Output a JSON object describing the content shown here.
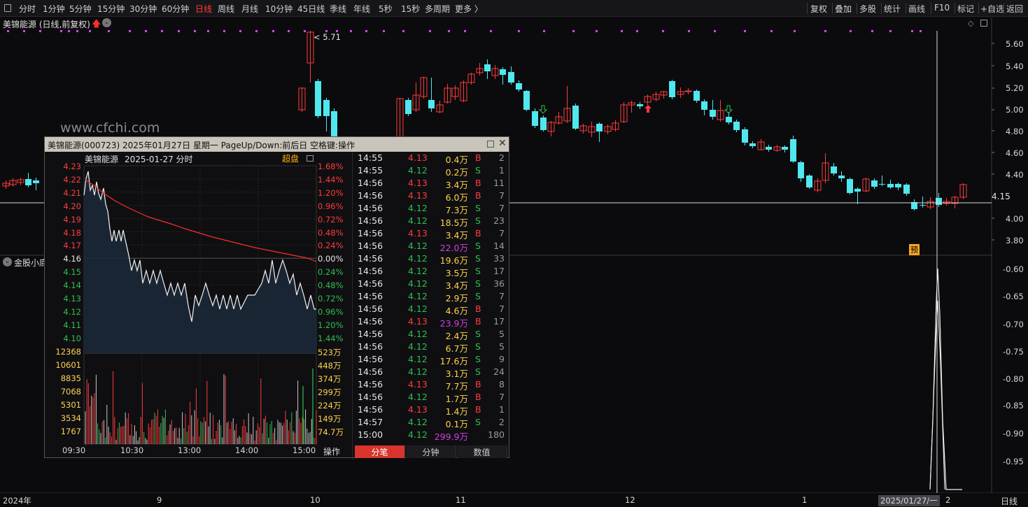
{
  "toolbar": {
    "periods": [
      "分时",
      "1分钟",
      "5分钟",
      "15分钟",
      "30分钟",
      "60分钟",
      "日线",
      "周线",
      "月线",
      "10分钟",
      "45日线",
      "季线",
      "年线",
      "5秒",
      "15秒",
      "多周期",
      "更多 〉"
    ],
    "active_period": "日线",
    "right_items": [
      "复权",
      "叠加",
      "多股",
      "统计",
      "画线",
      "F10",
      "标记",
      "+自选",
      "返回"
    ]
  },
  "chart": {
    "title": "美锦能源 (日线,前复权)",
    "peak_label": "5.71",
    "watermark": "www.cfchi.com",
    "last_price": "4.15",
    "y_ticks": [
      "5.60",
      "5.40",
      "5.20",
      "5.00",
      "4.80",
      "4.60",
      "4.40",
      "4.00",
      "3.80"
    ],
    "indicator_name": "金股小底",
    "ind_ticks": [
      "-0.60",
      "-0.65",
      "-0.70",
      "-0.75",
      "-0.80",
      "-0.85",
      "-0.90",
      "-0.95"
    ],
    "pre_badge": "预",
    "x_labels": [
      "2024年",
      "9",
      "10",
      "11",
      "12",
      "1",
      "2025/01/27/一",
      "2"
    ],
    "period_corner": "日线",
    "colors": {
      "up": "#ff3b3b",
      "down": "#4fe8f0",
      "bg": "#0b0b0d",
      "yellow": "#ffd24d",
      "green": "#2fbf4f"
    }
  },
  "popup": {
    "title": "美锦能源(000723)  2025年01月27日 星期一  PageUp/Down:前后日  空格键:操作",
    "stock_name": "美锦能源",
    "date_label": "2025-01-27 分时",
    "super_label": "超盘",
    "price_ticks": [
      "4.23",
      "4.22",
      "4.21",
      "4.20",
      "4.19",
      "4.18",
      "4.17",
      "4.16",
      "4.15",
      "4.14",
      "4.13",
      "4.12",
      "4.11",
      "4.10"
    ],
    "pct_ticks": [
      "1.68%",
      "1.44%",
      "1.20%",
      "0.96%",
      "0.72%",
      "0.48%",
      "0.24%",
      "0.00%",
      "0.24%",
      "0.48%",
      "0.72%",
      "0.96%",
      "1.20%",
      "1.44%"
    ],
    "vol_ticks_left": [
      "12368",
      "10601",
      "8835",
      "7068",
      "5301",
      "3534",
      "1767"
    ],
    "vol_ticks_right": [
      "523万",
      "448万",
      "374万",
      "299万",
      "224万",
      "149万",
      "74.7万"
    ],
    "time_labels": [
      "09:30",
      "10:30",
      "13:00",
      "14:00",
      "15:00"
    ],
    "op_label": "操作",
    "tabs": [
      "分笔",
      "分钟",
      "数值"
    ],
    "active_tab": "分笔",
    "trades": [
      {
        "time": "14:55",
        "price": "4.13",
        "amount": "0.4万",
        "side": "B",
        "count": "2"
      },
      {
        "time": "14:55",
        "price": "4.12",
        "amount": "0.2万",
        "side": "S",
        "count": "1"
      },
      {
        "time": "14:56",
        "price": "4.13",
        "amount": "3.4万",
        "side": "B",
        "count": "11"
      },
      {
        "time": "14:56",
        "price": "4.13",
        "amount": "6.0万",
        "side": "B",
        "count": "7"
      },
      {
        "time": "14:56",
        "price": "4.12",
        "amount": "7.3万",
        "side": "S",
        "count": "7"
      },
      {
        "time": "14:56",
        "price": "4.12",
        "amount": "18.5万",
        "side": "S",
        "count": "23"
      },
      {
        "time": "14:56",
        "price": "4.13",
        "amount": "3.4万",
        "side": "B",
        "count": "7"
      },
      {
        "time": "14:56",
        "price": "4.12",
        "amount": "22.0万",
        "side": "S",
        "count": "14"
      },
      {
        "time": "14:56",
        "price": "4.12",
        "amount": "19.6万",
        "side": "S",
        "count": "33"
      },
      {
        "time": "14:56",
        "price": "4.12",
        "amount": "3.5万",
        "side": "S",
        "count": "17"
      },
      {
        "time": "14:56",
        "price": "4.12",
        "amount": "3.4万",
        "side": "S",
        "count": "36"
      },
      {
        "time": "14:56",
        "price": "4.12",
        "amount": "2.9万",
        "side": "S",
        "count": "7"
      },
      {
        "time": "14:56",
        "price": "4.12",
        "amount": "4.6万",
        "side": "B",
        "count": "7"
      },
      {
        "time": "14:56",
        "price": "4.13",
        "amount": "23.9万",
        "side": "B",
        "count": "17"
      },
      {
        "time": "14:56",
        "price": "4.12",
        "amount": "2.4万",
        "side": "S",
        "count": "5"
      },
      {
        "time": "14:56",
        "price": "4.12",
        "amount": "6.7万",
        "side": "S",
        "count": "5"
      },
      {
        "time": "14:56",
        "price": "4.12",
        "amount": "17.6万",
        "side": "S",
        "count": "9"
      },
      {
        "time": "14:56",
        "price": "4.12",
        "amount": "3.1万",
        "side": "S",
        "count": "24"
      },
      {
        "time": "14:56",
        "price": "4.13",
        "amount": "7.7万",
        "side": "B",
        "count": "8"
      },
      {
        "time": "14:56",
        "price": "4.12",
        "amount": "1.7万",
        "side": "B",
        "count": "7"
      },
      {
        "time": "14:56",
        "price": "4.13",
        "amount": "1.4万",
        "side": "B",
        "count": "1"
      },
      {
        "time": "14:57",
        "price": "4.12",
        "amount": "0.1万",
        "side": "S",
        "count": "2"
      },
      {
        "time": "15:00",
        "price": "4.12",
        "amount": "299.9万",
        "side": "",
        "count": "180"
      }
    ]
  }
}
